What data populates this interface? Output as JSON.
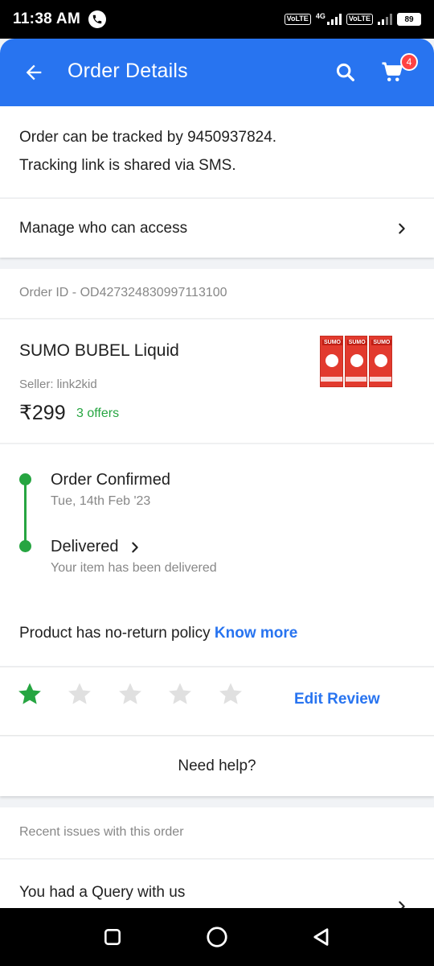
{
  "status_bar": {
    "time": "11:38 AM",
    "sim1_label": "VoLTE",
    "network_type": "4G",
    "sim2_label": "VoLTE",
    "battery": "89",
    "icons": [
      "call-icon",
      "signal-icon",
      "battery-icon"
    ]
  },
  "app_bar": {
    "title": "Order Details",
    "cart_count": "4",
    "icons": [
      "back-arrow-icon",
      "search-icon",
      "cart-icon"
    ],
    "color": "#2874f0"
  },
  "tracking": {
    "line1": "Order can be tracked by 9450937824.",
    "line2": "Tracking link is shared via SMS."
  },
  "manage_access": {
    "label": "Manage who can access"
  },
  "order": {
    "id_text": "Order ID - OD427324830997113100"
  },
  "product": {
    "name": "SUMO BUBEL Liquid",
    "seller": "Seller: link2kid",
    "price": "₹299",
    "offers": "3 offers",
    "image_brand_text": "SUMO"
  },
  "timeline": {
    "steps": [
      {
        "title": "Order Confirmed",
        "subtitle": "Tue, 14th Feb '23"
      },
      {
        "title": "Delivered",
        "subtitle": "Your item has been delivered"
      }
    ],
    "accent_color": "#26a541"
  },
  "policy": {
    "text": "Product has no-return policy ",
    "link": "Know more"
  },
  "rating": {
    "value": 1,
    "max": 5,
    "edit_label": "Edit Review",
    "filled_color": "#26a541",
    "empty_color": "#e0e0e0"
  },
  "help": {
    "label": "Need help?"
  },
  "recent_issues": {
    "label": "Recent issues with this order",
    "query_label": "You had a Query with us"
  },
  "nav_bar": {
    "icons": [
      "recent-apps-icon",
      "home-icon",
      "back-icon"
    ]
  }
}
